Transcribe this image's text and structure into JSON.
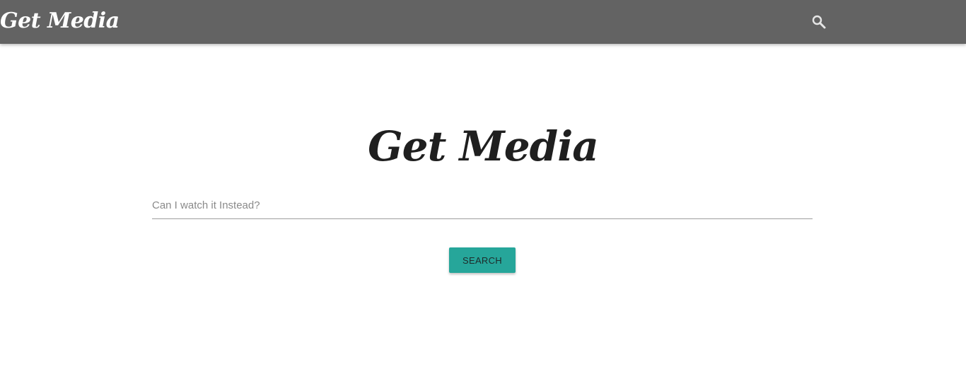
{
  "navbar": {
    "brand": "Get Media",
    "search_icon": "search-icon",
    "background_color": "#636363"
  },
  "main": {
    "title": "Get Media",
    "search": {
      "placeholder": "Can I watch it Instead?",
      "value": ""
    },
    "search_button_label": "SEARCH",
    "accent_color": "#26a69a"
  }
}
